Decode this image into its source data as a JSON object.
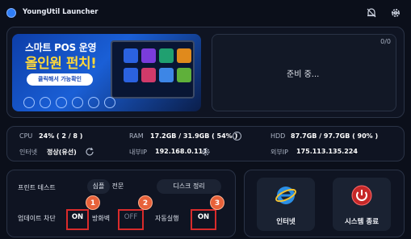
{
  "window": {
    "title": "YoungUtil Launcher"
  },
  "titlebar": {
    "icons": [
      "notification-off-icon",
      "gear-icon",
      "minimize-icon"
    ]
  },
  "banner": {
    "line1": "스마트 POS 운영",
    "line2": "올인원 펀치!",
    "button_label": "클릭해서 가능확인"
  },
  "status": {
    "count": "0/0",
    "message": "준비 중..."
  },
  "system": {
    "cpu_label": "CPU",
    "cpu_value": "24% ( 2 / 8 )",
    "ram_label": "RAM",
    "ram_value": "17.2GB / 31.9GB ( 54% )",
    "hdd_label": "HDD",
    "hdd_value": "87.7GB / 97.7GB ( 90% )",
    "internet_label": "인터넷",
    "internet_value": "정상(유선)",
    "internal_ip_label": "내부IP",
    "internal_ip_value": "192.168.0.111",
    "external_ip_label": "외부IP",
    "external_ip_value": "175.113.135.224"
  },
  "tools": {
    "print_test_label": "프린트 테스트",
    "simple_label": "심플",
    "full_label": "전문",
    "disk_cleanup_label": "디스크 정리",
    "update_block_label": "업데이트 차단",
    "update_block_value": "ON",
    "firewall_label": "방화벽",
    "firewall_value": "OFF",
    "autorun_label": "자동실행",
    "autorun_value": "ON"
  },
  "markers": [
    "1",
    "2",
    "3"
  ],
  "actions": {
    "internet_label": "인터넷",
    "shutdown_label": "시스템 종료"
  },
  "colors": {
    "accent": "#2f7df6",
    "highlight": "#d92b2b",
    "marker": "#e8623a",
    "off": "#7b8496"
  }
}
